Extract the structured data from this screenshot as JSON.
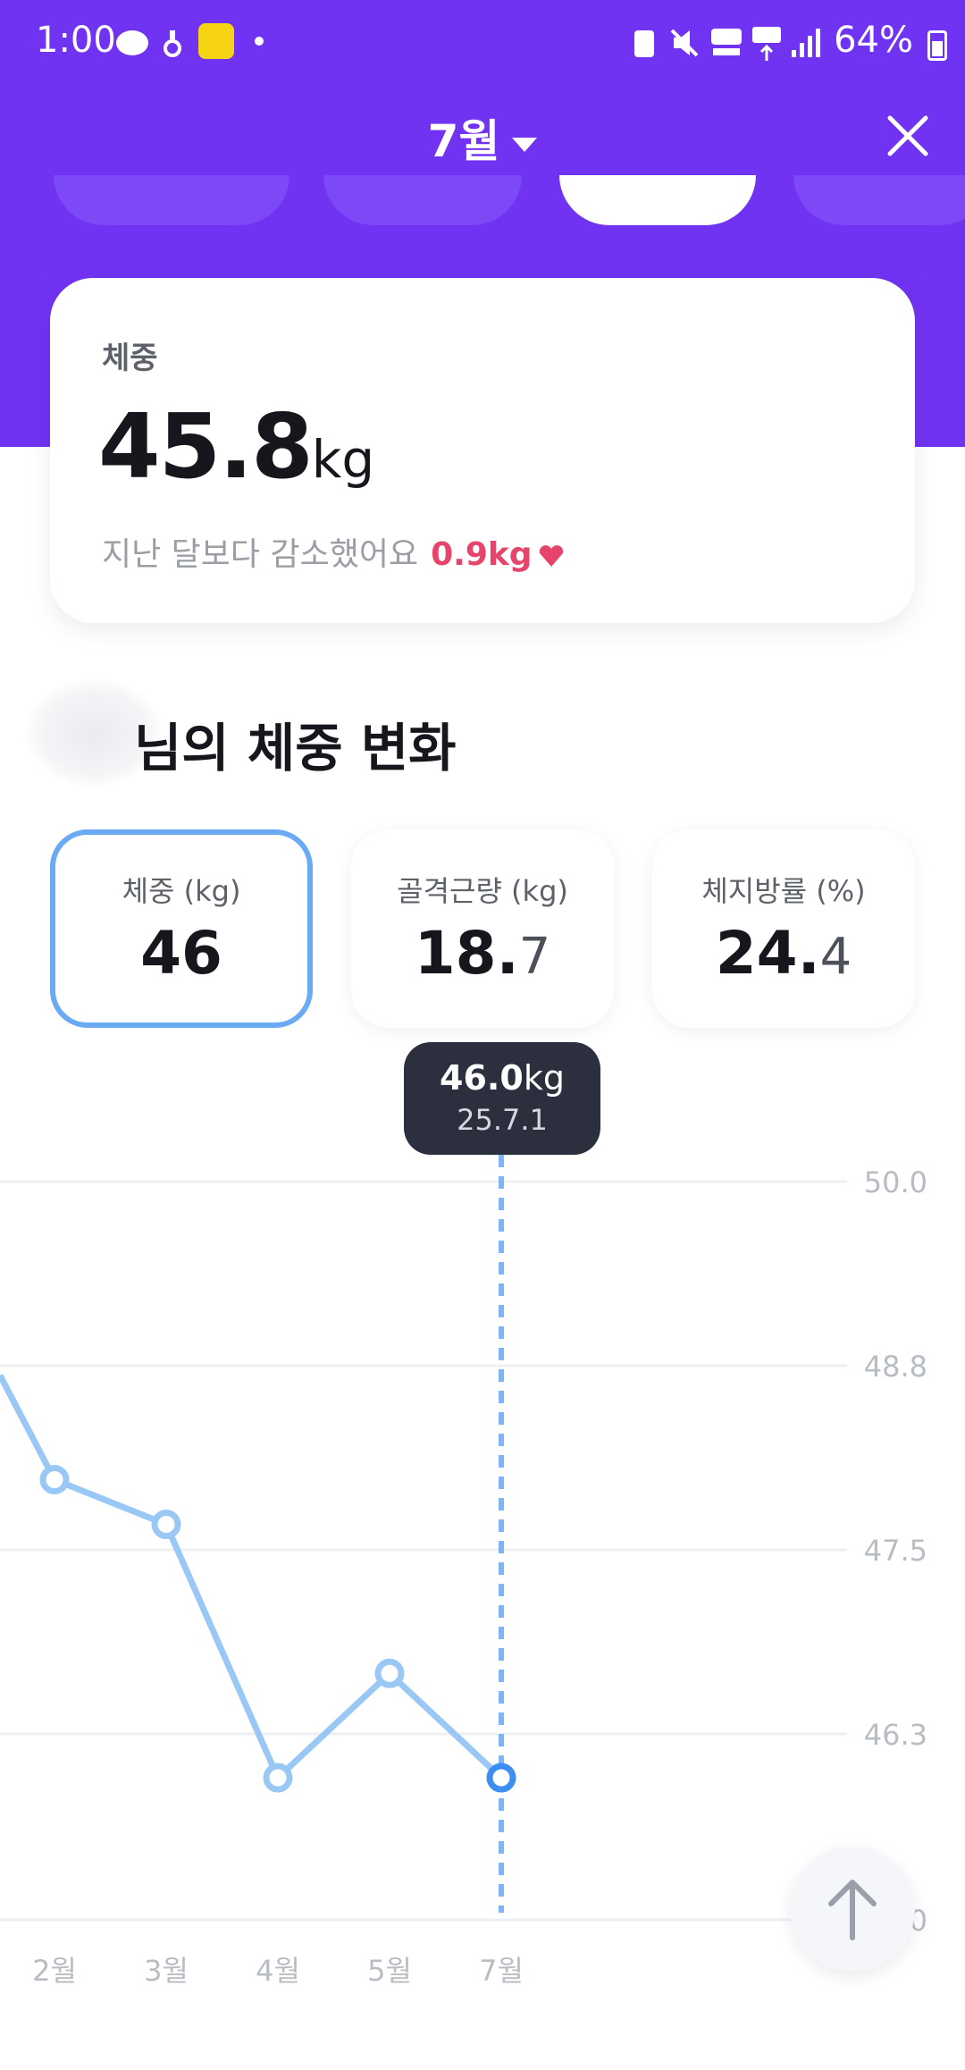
{
  "status_bar": {
    "time": "1:00",
    "battery": "64%"
  },
  "header": {
    "month": "7월"
  },
  "summary": {
    "label": "체중",
    "value": "45.8",
    "unit": "kg",
    "change_text": "지난 달보다 감소했어요",
    "change_value": "0.9kg"
  },
  "section": {
    "title": "님의 체중 변화"
  },
  "tiles": [
    {
      "label": "체중 (kg)",
      "int": "46",
      "dec": ""
    },
    {
      "label": "골격근량 (kg)",
      "int": "18.",
      "dec": "7"
    },
    {
      "label": "체지방률 (%)",
      "int": "24.",
      "dec": "4"
    }
  ],
  "tooltip": {
    "value": "46.0",
    "unit": "kg",
    "date": "25.7.1"
  },
  "chart_data": {
    "type": "line",
    "series": [
      {
        "values": [
          48.0,
          47.7,
          46.0,
          46.7,
          46.0
        ]
      }
    ],
    "x": [
      "2월",
      "3월",
      "4월",
      "5월",
      "7월"
    ],
    "y_ticks": [
      "50.0",
      "48.8",
      "47.5",
      "46.3",
      "0"
    ],
    "ylim": [
      45.0,
      50.0
    ],
    "selected": "7월",
    "grid": true,
    "colors": {
      "line": "#9ac8f5",
      "selected": "#3d8ef0"
    }
  },
  "colors": {
    "brand": "#7133F2",
    "decrease": "#e6446b",
    "selected_border": "#6aaaf2"
  }
}
